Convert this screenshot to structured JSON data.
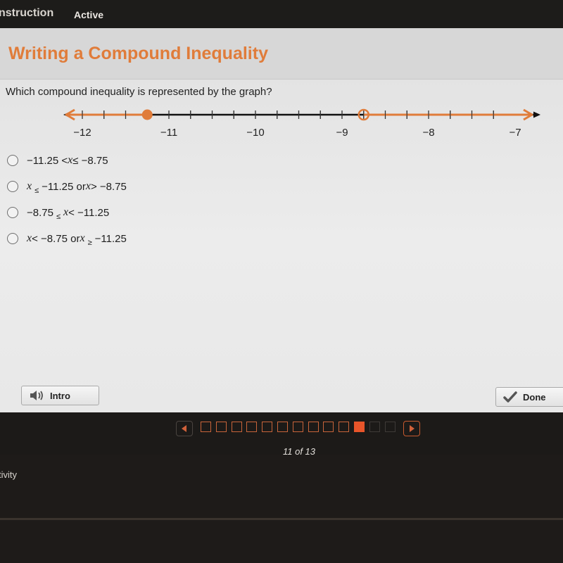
{
  "topbar": {
    "tabs": [
      {
        "label": "nstruction"
      },
      {
        "label": "Active"
      }
    ]
  },
  "lesson": {
    "title": "Writing a Compound Inequality",
    "question": "Which compound inequality is represented by the graph?"
  },
  "number_line": {
    "min": -12.25,
    "max": -6.75,
    "labels": [
      "−12",
      "−11",
      "−10",
      "−9",
      "−8",
      "−7"
    ],
    "label_values": [
      -12,
      -11,
      -10,
      -9,
      -8,
      -7
    ],
    "tick_step": 0.25,
    "points": [
      {
        "value": -11.25,
        "type": "closed"
      },
      {
        "value": -8.75,
        "type": "open"
      }
    ],
    "rays": [
      {
        "from": -11.25,
        "direction": "left"
      },
      {
        "from": -8.75,
        "direction": "right"
      }
    ],
    "colors": {
      "accent": "#e07c3a",
      "axis": "#111111"
    }
  },
  "choices": [
    {
      "parts": [
        "−11.25 < ",
        "x",
        " ≤ −8.75"
      ]
    },
    {
      "parts": [
        "x",
        "≤",
        "−11.25 or ",
        "x",
        " > −8.75"
      ]
    },
    {
      "parts": [
        "−8.75 ",
        "≤",
        "x",
        " < −11.25"
      ]
    },
    {
      "parts": [
        "x",
        " < −8.75 or ",
        "x",
        "≥",
        "−11.25"
      ]
    }
  ],
  "buttons": {
    "intro": {
      "label": "Intro",
      "icon": "speaker-icon"
    },
    "done": {
      "label": "Done",
      "icon": "checkmark-icon"
    }
  },
  "pager": {
    "current": 11,
    "total": 13,
    "count_label": "11 of 13"
  },
  "footer": {
    "text": "tivity"
  },
  "colors": {
    "accent": "#e07c3a",
    "pager_current": "#e8552a"
  }
}
